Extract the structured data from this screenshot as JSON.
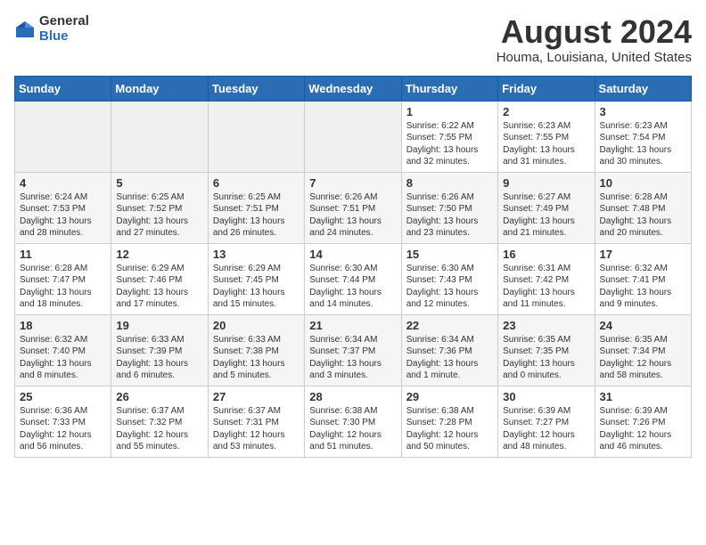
{
  "header": {
    "logo_general": "General",
    "logo_blue": "Blue",
    "month_title": "August 2024",
    "location": "Houma, Louisiana, United States"
  },
  "weekdays": [
    "Sunday",
    "Monday",
    "Tuesday",
    "Wednesday",
    "Thursday",
    "Friday",
    "Saturday"
  ],
  "weeks": [
    [
      {
        "day": "",
        "empty": true
      },
      {
        "day": "",
        "empty": true
      },
      {
        "day": "",
        "empty": true
      },
      {
        "day": "",
        "empty": true
      },
      {
        "day": "1",
        "sunrise": "Sunrise: 6:22 AM",
        "sunset": "Sunset: 7:55 PM",
        "daylight": "Daylight: 13 hours and 32 minutes."
      },
      {
        "day": "2",
        "sunrise": "Sunrise: 6:23 AM",
        "sunset": "Sunset: 7:55 PM",
        "daylight": "Daylight: 13 hours and 31 minutes."
      },
      {
        "day": "3",
        "sunrise": "Sunrise: 6:23 AM",
        "sunset": "Sunset: 7:54 PM",
        "daylight": "Daylight: 13 hours and 30 minutes."
      }
    ],
    [
      {
        "day": "4",
        "sunrise": "Sunrise: 6:24 AM",
        "sunset": "Sunset: 7:53 PM",
        "daylight": "Daylight: 13 hours and 28 minutes."
      },
      {
        "day": "5",
        "sunrise": "Sunrise: 6:25 AM",
        "sunset": "Sunset: 7:52 PM",
        "daylight": "Daylight: 13 hours and 27 minutes."
      },
      {
        "day": "6",
        "sunrise": "Sunrise: 6:25 AM",
        "sunset": "Sunset: 7:51 PM",
        "daylight": "Daylight: 13 hours and 26 minutes."
      },
      {
        "day": "7",
        "sunrise": "Sunrise: 6:26 AM",
        "sunset": "Sunset: 7:51 PM",
        "daylight": "Daylight: 13 hours and 24 minutes."
      },
      {
        "day": "8",
        "sunrise": "Sunrise: 6:26 AM",
        "sunset": "Sunset: 7:50 PM",
        "daylight": "Daylight: 13 hours and 23 minutes."
      },
      {
        "day": "9",
        "sunrise": "Sunrise: 6:27 AM",
        "sunset": "Sunset: 7:49 PM",
        "daylight": "Daylight: 13 hours and 21 minutes."
      },
      {
        "day": "10",
        "sunrise": "Sunrise: 6:28 AM",
        "sunset": "Sunset: 7:48 PM",
        "daylight": "Daylight: 13 hours and 20 minutes."
      }
    ],
    [
      {
        "day": "11",
        "sunrise": "Sunrise: 6:28 AM",
        "sunset": "Sunset: 7:47 PM",
        "daylight": "Daylight: 13 hours and 18 minutes."
      },
      {
        "day": "12",
        "sunrise": "Sunrise: 6:29 AM",
        "sunset": "Sunset: 7:46 PM",
        "daylight": "Daylight: 13 hours and 17 minutes."
      },
      {
        "day": "13",
        "sunrise": "Sunrise: 6:29 AM",
        "sunset": "Sunset: 7:45 PM",
        "daylight": "Daylight: 13 hours and 15 minutes."
      },
      {
        "day": "14",
        "sunrise": "Sunrise: 6:30 AM",
        "sunset": "Sunset: 7:44 PM",
        "daylight": "Daylight: 13 hours and 14 minutes."
      },
      {
        "day": "15",
        "sunrise": "Sunrise: 6:30 AM",
        "sunset": "Sunset: 7:43 PM",
        "daylight": "Daylight: 13 hours and 12 minutes."
      },
      {
        "day": "16",
        "sunrise": "Sunrise: 6:31 AM",
        "sunset": "Sunset: 7:42 PM",
        "daylight": "Daylight: 13 hours and 11 minutes."
      },
      {
        "day": "17",
        "sunrise": "Sunrise: 6:32 AM",
        "sunset": "Sunset: 7:41 PM",
        "daylight": "Daylight: 13 hours and 9 minutes."
      }
    ],
    [
      {
        "day": "18",
        "sunrise": "Sunrise: 6:32 AM",
        "sunset": "Sunset: 7:40 PM",
        "daylight": "Daylight: 13 hours and 8 minutes."
      },
      {
        "day": "19",
        "sunrise": "Sunrise: 6:33 AM",
        "sunset": "Sunset: 7:39 PM",
        "daylight": "Daylight: 13 hours and 6 minutes."
      },
      {
        "day": "20",
        "sunrise": "Sunrise: 6:33 AM",
        "sunset": "Sunset: 7:38 PM",
        "daylight": "Daylight: 13 hours and 5 minutes."
      },
      {
        "day": "21",
        "sunrise": "Sunrise: 6:34 AM",
        "sunset": "Sunset: 7:37 PM",
        "daylight": "Daylight: 13 hours and 3 minutes."
      },
      {
        "day": "22",
        "sunrise": "Sunrise: 6:34 AM",
        "sunset": "Sunset: 7:36 PM",
        "daylight": "Daylight: 13 hours and 1 minute."
      },
      {
        "day": "23",
        "sunrise": "Sunrise: 6:35 AM",
        "sunset": "Sunset: 7:35 PM",
        "daylight": "Daylight: 13 hours and 0 minutes."
      },
      {
        "day": "24",
        "sunrise": "Sunrise: 6:35 AM",
        "sunset": "Sunset: 7:34 PM",
        "daylight": "Daylight: 12 hours and 58 minutes."
      }
    ],
    [
      {
        "day": "25",
        "sunrise": "Sunrise: 6:36 AM",
        "sunset": "Sunset: 7:33 PM",
        "daylight": "Daylight: 12 hours and 56 minutes."
      },
      {
        "day": "26",
        "sunrise": "Sunrise: 6:37 AM",
        "sunset": "Sunset: 7:32 PM",
        "daylight": "Daylight: 12 hours and 55 minutes."
      },
      {
        "day": "27",
        "sunrise": "Sunrise: 6:37 AM",
        "sunset": "Sunset: 7:31 PM",
        "daylight": "Daylight: 12 hours and 53 minutes."
      },
      {
        "day": "28",
        "sunrise": "Sunrise: 6:38 AM",
        "sunset": "Sunset: 7:30 PM",
        "daylight": "Daylight: 12 hours and 51 minutes."
      },
      {
        "day": "29",
        "sunrise": "Sunrise: 6:38 AM",
        "sunset": "Sunset: 7:28 PM",
        "daylight": "Daylight: 12 hours and 50 minutes."
      },
      {
        "day": "30",
        "sunrise": "Sunrise: 6:39 AM",
        "sunset": "Sunset: 7:27 PM",
        "daylight": "Daylight: 12 hours and 48 minutes."
      },
      {
        "day": "31",
        "sunrise": "Sunrise: 6:39 AM",
        "sunset": "Sunset: 7:26 PM",
        "daylight": "Daylight: 12 hours and 46 minutes."
      }
    ]
  ]
}
